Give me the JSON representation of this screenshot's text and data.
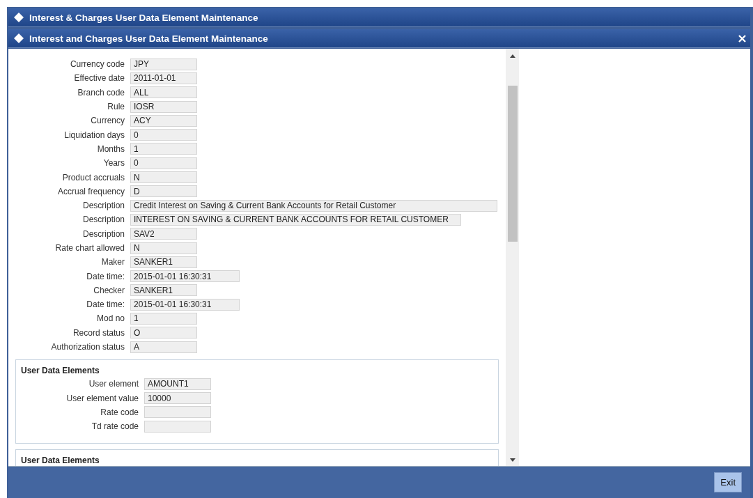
{
  "outer_window": {
    "title": "Interest & Charges User Data Element Maintenance"
  },
  "dialog": {
    "title": "Interest and Charges User Data Element Maintenance"
  },
  "fields": [
    {
      "label": "Currency code",
      "value": "JPY"
    },
    {
      "label": "Effective date",
      "value": "2011-01-01"
    },
    {
      "label": "Branch code",
      "value": "ALL"
    },
    {
      "label": "Rule",
      "value": "IOSR"
    },
    {
      "label": "Currency",
      "value": "ACY"
    },
    {
      "label": "Liquidation days",
      "value": "0"
    },
    {
      "label": "Months",
      "value": "1"
    },
    {
      "label": "Years",
      "value": "0"
    },
    {
      "label": "Product accruals",
      "value": "N"
    },
    {
      "label": "Accrual frequency",
      "value": "D"
    },
    {
      "label": "Description",
      "value": "Credit Interest on Saving & Current Bank Accounts for Retail Customer"
    },
    {
      "label": "Description",
      "value": "INTEREST ON SAVING & CURRENT BANK ACCOUNTS FOR RETAIL CUSTOMER"
    },
    {
      "label": "Description",
      "value": "SAV2"
    },
    {
      "label": "Rate chart allowed",
      "value": "N"
    },
    {
      "label": "Maker",
      "value": "SANKER1"
    },
    {
      "label": "Date time:",
      "value": "2015-01-01 16:30:31"
    },
    {
      "label": "Checker",
      "value": "SANKER1"
    },
    {
      "label": "Date time:",
      "value": "2015-01-01 16:30:31"
    },
    {
      "label": "Mod no",
      "value": "1"
    },
    {
      "label": "Record status",
      "value": "O"
    },
    {
      "label": "Authorization status",
      "value": "A"
    }
  ],
  "sections": [
    {
      "title": "User Data Elements",
      "fields": [
        {
          "label": "User element",
          "value": "AMOUNT1"
        },
        {
          "label": "User element value",
          "value": "10000"
        },
        {
          "label": "Rate code"
        },
        {
          "label": "Td rate code"
        }
      ]
    },
    {
      "title": "User Data Elements"
    }
  ],
  "footer": {
    "buttons": [
      "Exit"
    ]
  }
}
